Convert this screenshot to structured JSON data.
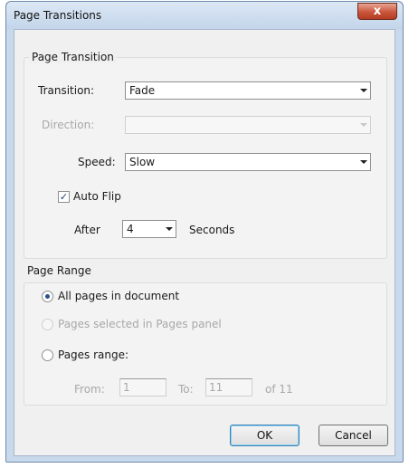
{
  "window": {
    "title": "Page Transitions",
    "close_label": "x"
  },
  "page_transition": {
    "group_label": "Page Transition",
    "transition_label": "Transition:",
    "transition_value": "Fade",
    "direction_label": "Direction:",
    "direction_value": "",
    "speed_label": "Speed:",
    "speed_value": "Slow",
    "auto_flip_label": "Auto Flip",
    "auto_flip_checked": true,
    "after_label": "After",
    "after_value": "4",
    "seconds_label": "Seconds"
  },
  "page_range": {
    "group_label": "Page Range",
    "all_pages_label": "All pages in document",
    "selected_pages_label": "Pages selected in Pages panel",
    "pages_range_label": "Pages range:",
    "from_label": "From:",
    "from_value": "1",
    "to_label": "To:",
    "to_value": "11",
    "of_label": "of 11"
  },
  "buttons": {
    "ok_label": "OK",
    "cancel_label": "Cancel"
  }
}
